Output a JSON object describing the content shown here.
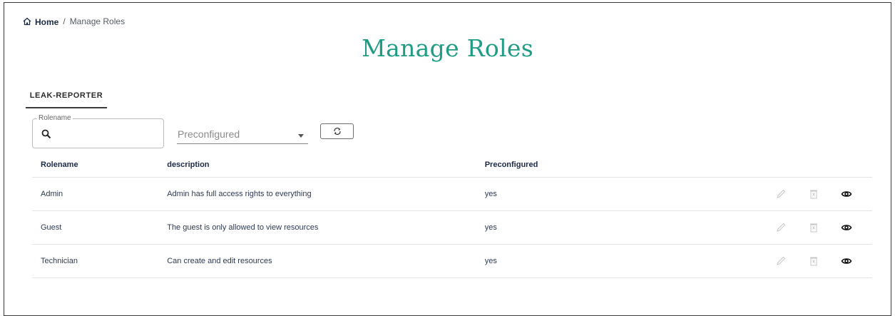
{
  "breadcrumb": {
    "home": "Home",
    "separator": "/",
    "current": "Manage Roles"
  },
  "page": {
    "title": "Manage Roles"
  },
  "tabs": [
    {
      "label": "LEAK-REPORTER",
      "active": true
    }
  ],
  "filters": {
    "rolename_label": "Rolename",
    "rolename_value": "",
    "preconfigured_placeholder": "Preconfigured"
  },
  "table": {
    "columns": [
      "Rolename",
      "description",
      "Preconfigured"
    ],
    "rows": [
      {
        "rolename": "Admin",
        "description": "Admin has full access rights to everything",
        "preconfigured": "yes"
      },
      {
        "rolename": "Guest",
        "description": "The guest is only allowed to view resources",
        "preconfigured": "yes"
      },
      {
        "rolename": "Technician",
        "description": "Can create and edit resources",
        "preconfigured": "yes"
      }
    ]
  },
  "icons": {
    "home": "home-icon",
    "search": "search-icon",
    "refresh": "refresh-icon",
    "edit": "pencil-icon",
    "delete": "trash-icon",
    "view": "eye-icon"
  },
  "colors": {
    "title": "#1f9c84",
    "header_text": "#1b2a47",
    "disabled_icon": "#c4c4c4"
  }
}
